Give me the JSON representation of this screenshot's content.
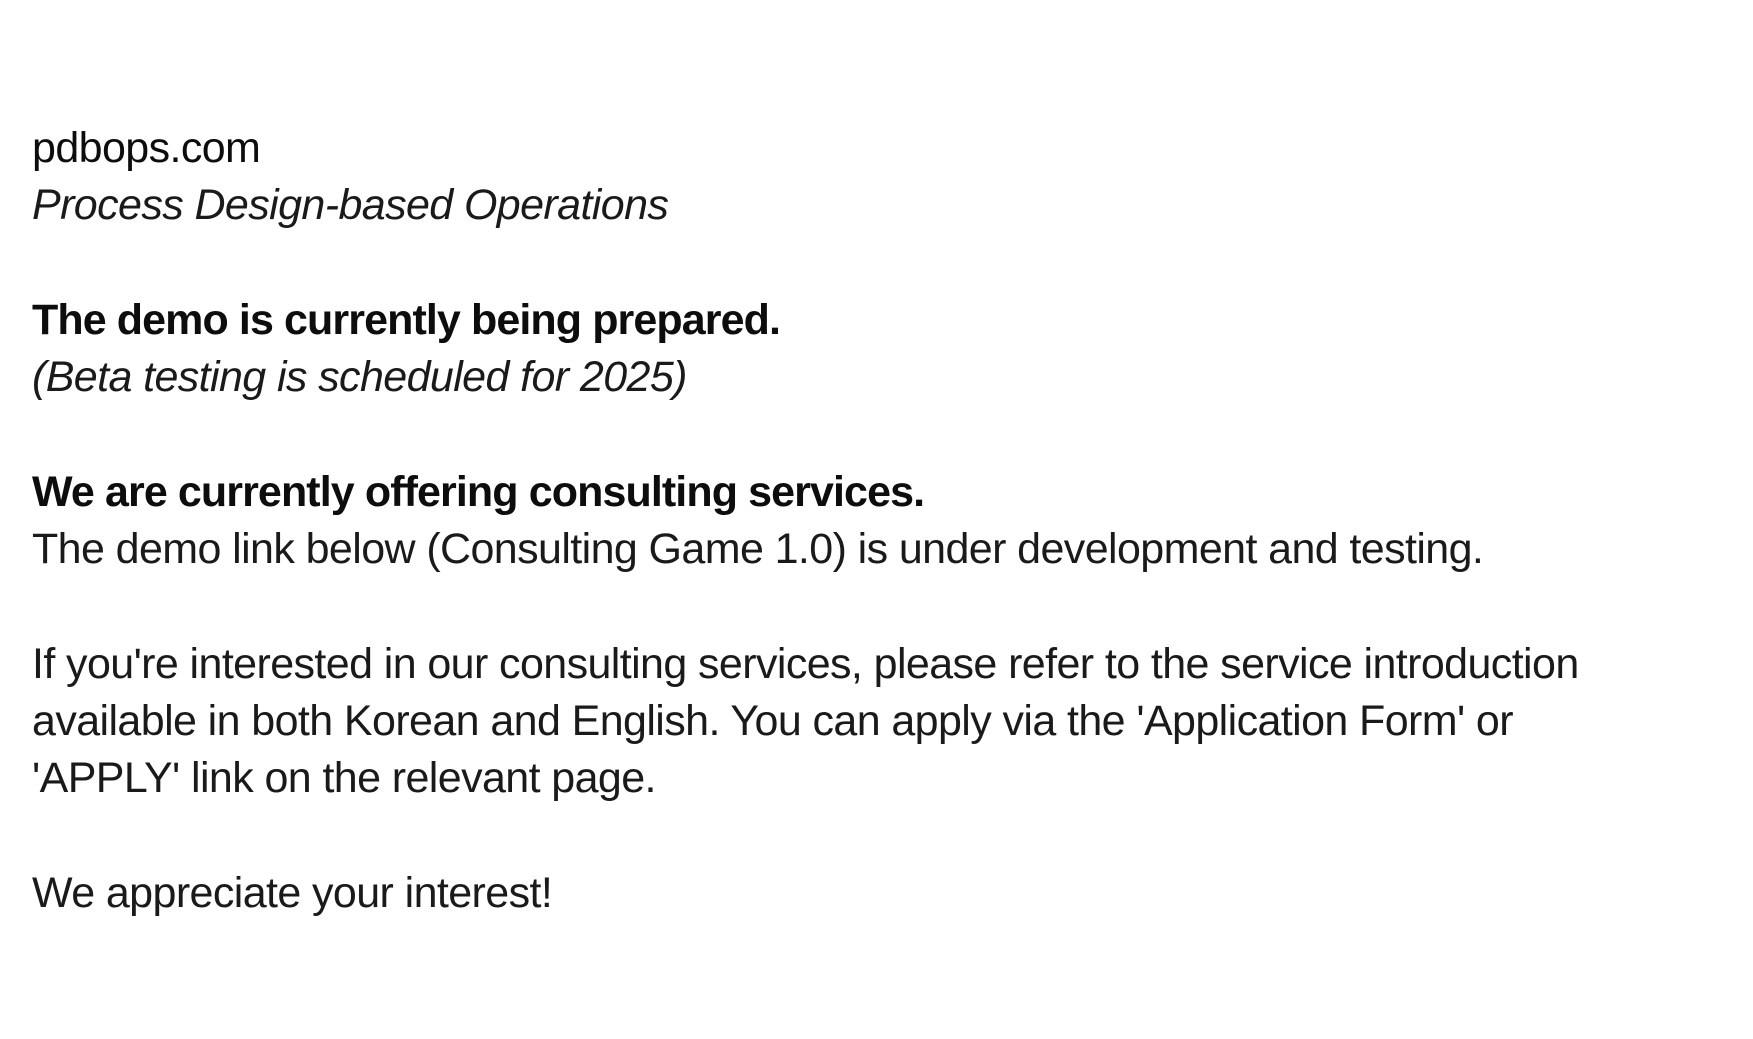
{
  "header": {
    "site_name": "pdbops.com",
    "tagline": "Process Design-based Operations"
  },
  "demo_notice": {
    "heading": "The demo is currently being prepared.",
    "note": "(Beta testing is scheduled for 2025)"
  },
  "consulting": {
    "heading": "We are currently offering consulting services.",
    "demo_link_text": "The demo link below (Consulting Game 1.0) is under development and testing.",
    "info_line_1": "If you're interested in our consulting services, please refer to the service introduction",
    "info_line_2": "available in both Korean and English. You can apply via the 'Application Form' or",
    "info_line_3": "'APPLY' link on the relevant page."
  },
  "closing": {
    "message": "We appreciate your interest!"
  }
}
